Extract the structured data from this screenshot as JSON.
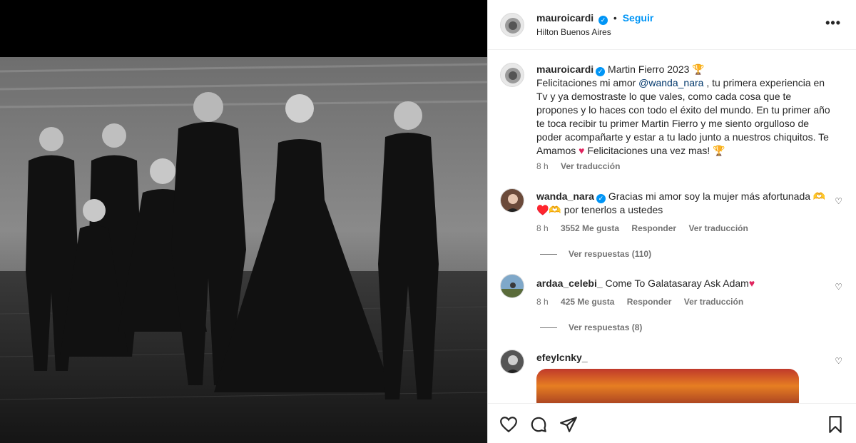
{
  "header": {
    "username": "mauroicardi",
    "follow_label": "Seguir",
    "location": "Hilton Buenos Aires",
    "more_icon": "more-horizontal-icon"
  },
  "caption": {
    "username": "mauroicardi",
    "title": "Martin Fierro 2023",
    "text_1": "Felicitaciones mi amor ",
    "mention": "@wanda_nara",
    "text_2": " , tu primera experiencia en Tv y ya demostraste lo que vales, como cada cosa que te propones y lo haces con todo el éxito del mundo. En tu primer año te toca recibir tu primer Martin Fierro y me siento orgulloso de poder acompañarte y estar a tu lado junto a nuestros chiquitos. Te Amamos ",
    "text_3": " Felicitaciones una vez mas! ",
    "time": "8 h",
    "translate": "Ver traducción"
  },
  "comments": [
    {
      "username": "wanda_nara",
      "text": "Gracias mi amor soy la mujer más afortunada 🫶 ♥️🫶 por tenerlos a ustedes",
      "time": "8 h",
      "likes": "3552 Me gusta",
      "reply": "Responder",
      "translate": "Ver traducción",
      "view_replies": "Ver respuestas (110)"
    },
    {
      "username": "ardaa_celebi_",
      "text": "Come To Galatasaray Ask Adam",
      "time": "8 h",
      "likes": "425 Me gusta",
      "reply": "Responder",
      "translate": "Ver traducción",
      "view_replies": "Ver respuestas (8)"
    },
    {
      "username": "efeylcnky_"
    }
  ],
  "colors": {
    "accent": "#0095f6",
    "heart": "#e0245e",
    "trophy": "#c9a227"
  }
}
